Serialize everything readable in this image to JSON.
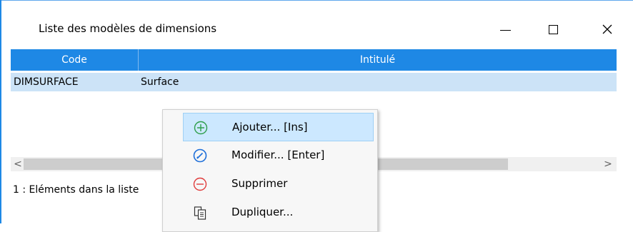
{
  "window": {
    "title": "Liste des modèles de dimensions",
    "accent_color": "#1e88e5"
  },
  "titlebar_buttons": [
    "minimize-icon",
    "maximize-icon",
    "close-icon"
  ],
  "grid": {
    "columns": [
      "Code",
      "Intitulé"
    ],
    "rows": [
      {
        "code": "DIMSURFACE",
        "intitule": "Surface"
      }
    ]
  },
  "scrollbar": {
    "left_arrow": "<",
    "right_arrow": ">"
  },
  "status": "1 : Eléments dans la liste",
  "context_menu": {
    "items": [
      {
        "label": "Ajouter... [Ins]",
        "icon": "add-circle-icon",
        "color": "#2e9e4a"
      },
      {
        "label": "Modifier... [Enter]",
        "icon": "edit-circle-icon",
        "color": "#1e6fd9"
      },
      {
        "label": "Supprimer",
        "icon": "remove-circle-icon",
        "color": "#e03c3c"
      },
      {
        "label": "Dupliquer...",
        "icon": "duplicate-icon",
        "color": "#333333"
      }
    ]
  }
}
